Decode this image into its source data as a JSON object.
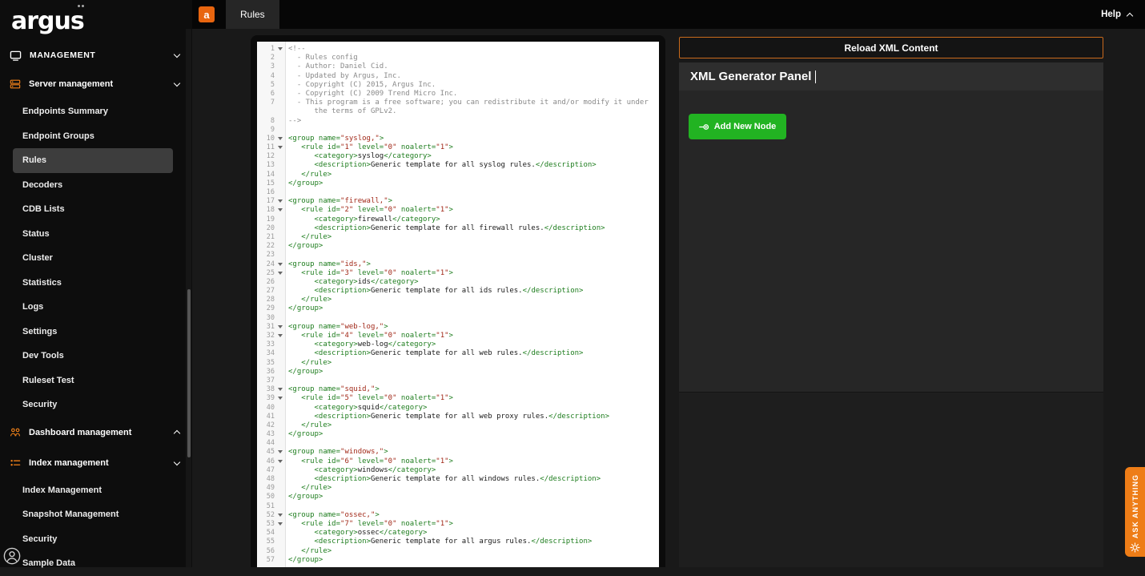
{
  "app": {
    "logo_text": "argus",
    "topbar": {
      "app_badge": "a",
      "tab_label": "Rules",
      "help_label": "Help"
    }
  },
  "sidebar": {
    "section_label": "MANAGEMENT",
    "items": [
      {
        "type": "group",
        "label": "Server management",
        "icon": "server",
        "chevron": "down"
      },
      {
        "type": "item",
        "label": "Endpoints Summary"
      },
      {
        "type": "item",
        "label": "Endpoint Groups"
      },
      {
        "type": "item",
        "label": "Rules",
        "selected": true
      },
      {
        "type": "item",
        "label": "Decoders"
      },
      {
        "type": "item",
        "label": "CDB Lists"
      },
      {
        "type": "item",
        "label": "Status"
      },
      {
        "type": "item",
        "label": "Cluster"
      },
      {
        "type": "item",
        "label": "Statistics"
      },
      {
        "type": "item",
        "label": "Logs"
      },
      {
        "type": "item",
        "label": "Settings"
      },
      {
        "type": "item",
        "label": "Dev Tools"
      },
      {
        "type": "item",
        "label": "Ruleset Test"
      },
      {
        "type": "item",
        "label": "Security"
      },
      {
        "type": "group",
        "label": "Dashboard management",
        "icon": "dashboard",
        "chevron": "up"
      },
      {
        "type": "group",
        "label": "Index management",
        "icon": "index",
        "chevron": "down"
      },
      {
        "type": "item",
        "label": "Index Management"
      },
      {
        "type": "item",
        "label": "Snapshot Management"
      },
      {
        "type": "item",
        "label": "Security"
      },
      {
        "type": "item",
        "label": "Sample Data"
      }
    ]
  },
  "panel": {
    "reload_button": "Reload XML Content",
    "title": "XML Generator Panel",
    "add_node_button": "Add New Node"
  },
  "ask_anything_label": "ASK ANYTHING",
  "colors": {
    "accent_orange": "#ee7d17",
    "green_button": "#22b322",
    "selected_item_bg": "#3d3d3d",
    "tag_green": "#1e7d1e",
    "string_red": "#a22a1a",
    "comment_gray": "#8a8a8a"
  },
  "editor": {
    "lines": [
      {
        "n": 1,
        "fold": true,
        "tokens": [
          [
            "c",
            "<!--"
          ]
        ]
      },
      {
        "n": 2,
        "tokens": [
          [
            "c",
            "  - Rules config"
          ]
        ]
      },
      {
        "n": 3,
        "tokens": [
          [
            "c",
            "  - Author: Daniel Cid."
          ]
        ]
      },
      {
        "n": 4,
        "tokens": [
          [
            "c",
            "  - Updated by Argus, Inc."
          ]
        ]
      },
      {
        "n": 5,
        "tokens": [
          [
            "c",
            "  - Copyright (C) 2015, Argus Inc."
          ]
        ]
      },
      {
        "n": 6,
        "tokens": [
          [
            "c",
            "  - Copyright (C) 2009 Trend Micro Inc."
          ]
        ]
      },
      {
        "n": 7,
        "tokens": [
          [
            "c",
            "  - This program is a free software; you can redistribute it and/or modify it under"
          ]
        ],
        "cont": "      the terms of GPLv2."
      },
      {
        "n": 8,
        "tokens": [
          [
            "c",
            "-->"
          ]
        ]
      },
      {
        "n": 9,
        "tokens": []
      },
      {
        "n": 10,
        "fold": true,
        "tokens": [
          [
            "g",
            "<group name="
          ],
          [
            "s",
            "\"syslog,\""
          ],
          [
            "g",
            ">"
          ]
        ]
      },
      {
        "n": 11,
        "fold": true,
        "tokens": [
          [
            "g",
            "   <rule id="
          ],
          [
            "s",
            "\"1\""
          ],
          [
            "g",
            " level="
          ],
          [
            "s",
            "\"0\""
          ],
          [
            "g",
            " noalert="
          ],
          [
            "s",
            "\"1\""
          ],
          [
            "g",
            ">"
          ]
        ]
      },
      {
        "n": 12,
        "tokens": [
          [
            "g",
            "      <category>"
          ],
          [
            "k",
            "syslog"
          ],
          [
            "g",
            "</category>"
          ]
        ]
      },
      {
        "n": 13,
        "tokens": [
          [
            "g",
            "      <description>"
          ],
          [
            "k",
            "Generic template for all syslog rules."
          ],
          [
            "g",
            "</description>"
          ]
        ]
      },
      {
        "n": 14,
        "tokens": [
          [
            "g",
            "   </rule>"
          ]
        ]
      },
      {
        "n": 15,
        "tokens": [
          [
            "g",
            "</group>"
          ]
        ]
      },
      {
        "n": 16,
        "tokens": []
      },
      {
        "n": 17,
        "fold": true,
        "tokens": [
          [
            "g",
            "<group name="
          ],
          [
            "s",
            "\"firewall,\""
          ],
          [
            "g",
            ">"
          ]
        ]
      },
      {
        "n": 18,
        "fold": true,
        "tokens": [
          [
            "g",
            "   <rule id="
          ],
          [
            "s",
            "\"2\""
          ],
          [
            "g",
            " level="
          ],
          [
            "s",
            "\"0\""
          ],
          [
            "g",
            " noalert="
          ],
          [
            "s",
            "\"1\""
          ],
          [
            "g",
            ">"
          ]
        ]
      },
      {
        "n": 19,
        "tokens": [
          [
            "g",
            "      <category>"
          ],
          [
            "k",
            "firewall"
          ],
          [
            "g",
            "</category>"
          ]
        ]
      },
      {
        "n": 20,
        "tokens": [
          [
            "g",
            "      <description>"
          ],
          [
            "k",
            "Generic template for all firewall rules."
          ],
          [
            "g",
            "</description>"
          ]
        ]
      },
      {
        "n": 21,
        "tokens": [
          [
            "g",
            "   </rule>"
          ]
        ]
      },
      {
        "n": 22,
        "tokens": [
          [
            "g",
            "</group>"
          ]
        ]
      },
      {
        "n": 23,
        "tokens": []
      },
      {
        "n": 24,
        "fold": true,
        "tokens": [
          [
            "g",
            "<group name="
          ],
          [
            "s",
            "\"ids,\""
          ],
          [
            "g",
            ">"
          ]
        ]
      },
      {
        "n": 25,
        "fold": true,
        "tokens": [
          [
            "g",
            "   <rule id="
          ],
          [
            "s",
            "\"3\""
          ],
          [
            "g",
            " level="
          ],
          [
            "s",
            "\"0\""
          ],
          [
            "g",
            " noalert="
          ],
          [
            "s",
            "\"1\""
          ],
          [
            "g",
            ">"
          ]
        ]
      },
      {
        "n": 26,
        "tokens": [
          [
            "g",
            "      <category>"
          ],
          [
            "k",
            "ids"
          ],
          [
            "g",
            "</category>"
          ]
        ]
      },
      {
        "n": 27,
        "tokens": [
          [
            "g",
            "      <description>"
          ],
          [
            "k",
            "Generic template for all ids rules."
          ],
          [
            "g",
            "</description>"
          ]
        ]
      },
      {
        "n": 28,
        "tokens": [
          [
            "g",
            "   </rule>"
          ]
        ]
      },
      {
        "n": 29,
        "tokens": [
          [
            "g",
            "</group>"
          ]
        ]
      },
      {
        "n": 30,
        "tokens": []
      },
      {
        "n": 31,
        "fold": true,
        "tokens": [
          [
            "g",
            "<group name="
          ],
          [
            "s",
            "\"web-log,\""
          ],
          [
            "g",
            ">"
          ]
        ]
      },
      {
        "n": 32,
        "fold": true,
        "tokens": [
          [
            "g",
            "   <rule id="
          ],
          [
            "s",
            "\"4\""
          ],
          [
            "g",
            " level="
          ],
          [
            "s",
            "\"0\""
          ],
          [
            "g",
            " noalert="
          ],
          [
            "s",
            "\"1\""
          ],
          [
            "g",
            ">"
          ]
        ]
      },
      {
        "n": 33,
        "tokens": [
          [
            "g",
            "      <category>"
          ],
          [
            "k",
            "web-log"
          ],
          [
            "g",
            "</category>"
          ]
        ]
      },
      {
        "n": 34,
        "tokens": [
          [
            "g",
            "      <description>"
          ],
          [
            "k",
            "Generic template for all web rules."
          ],
          [
            "g",
            "</description>"
          ]
        ]
      },
      {
        "n": 35,
        "tokens": [
          [
            "g",
            "   </rule>"
          ]
        ]
      },
      {
        "n": 36,
        "tokens": [
          [
            "g",
            "</group>"
          ]
        ]
      },
      {
        "n": 37,
        "tokens": []
      },
      {
        "n": 38,
        "fold": true,
        "tokens": [
          [
            "g",
            "<group name="
          ],
          [
            "s",
            "\"squid,\""
          ],
          [
            "g",
            ">"
          ]
        ]
      },
      {
        "n": 39,
        "fold": true,
        "tokens": [
          [
            "g",
            "   <rule id="
          ],
          [
            "s",
            "\"5\""
          ],
          [
            "g",
            " level="
          ],
          [
            "s",
            "\"0\""
          ],
          [
            "g",
            " noalert="
          ],
          [
            "s",
            "\"1\""
          ],
          [
            "g",
            ">"
          ]
        ]
      },
      {
        "n": 40,
        "tokens": [
          [
            "g",
            "      <category>"
          ],
          [
            "k",
            "squid"
          ],
          [
            "g",
            "</category>"
          ]
        ]
      },
      {
        "n": 41,
        "tokens": [
          [
            "g",
            "      <description>"
          ],
          [
            "k",
            "Generic template for all web proxy rules."
          ],
          [
            "g",
            "</description>"
          ]
        ]
      },
      {
        "n": 42,
        "tokens": [
          [
            "g",
            "   </rule>"
          ]
        ]
      },
      {
        "n": 43,
        "tokens": [
          [
            "g",
            "</group>"
          ]
        ]
      },
      {
        "n": 44,
        "tokens": []
      },
      {
        "n": 45,
        "fold": true,
        "tokens": [
          [
            "g",
            "<group name="
          ],
          [
            "s",
            "\"windows,\""
          ],
          [
            "g",
            ">"
          ]
        ]
      },
      {
        "n": 46,
        "fold": true,
        "tokens": [
          [
            "g",
            "   <rule id="
          ],
          [
            "s",
            "\"6\""
          ],
          [
            "g",
            " level="
          ],
          [
            "s",
            "\"0\""
          ],
          [
            "g",
            " noalert="
          ],
          [
            "s",
            "\"1\""
          ],
          [
            "g",
            ">"
          ]
        ]
      },
      {
        "n": 47,
        "tokens": [
          [
            "g",
            "      <category>"
          ],
          [
            "k",
            "windows"
          ],
          [
            "g",
            "</category>"
          ]
        ]
      },
      {
        "n": 48,
        "tokens": [
          [
            "g",
            "      <description>"
          ],
          [
            "k",
            "Generic template for all windows rules."
          ],
          [
            "g",
            "</description>"
          ]
        ]
      },
      {
        "n": 49,
        "tokens": [
          [
            "g",
            "   </rule>"
          ]
        ]
      },
      {
        "n": 50,
        "tokens": [
          [
            "g",
            "</group>"
          ]
        ]
      },
      {
        "n": 51,
        "tokens": []
      },
      {
        "n": 52,
        "fold": true,
        "tokens": [
          [
            "g",
            "<group name="
          ],
          [
            "s",
            "\"ossec,\""
          ],
          [
            "g",
            ">"
          ]
        ]
      },
      {
        "n": 53,
        "fold": true,
        "tokens": [
          [
            "g",
            "   <rule id="
          ],
          [
            "s",
            "\"7\""
          ],
          [
            "g",
            " level="
          ],
          [
            "s",
            "\"0\""
          ],
          [
            "g",
            " noalert="
          ],
          [
            "s",
            "\"1\""
          ],
          [
            "g",
            ">"
          ]
        ]
      },
      {
        "n": 54,
        "tokens": [
          [
            "g",
            "      <category>"
          ],
          [
            "k",
            "ossec"
          ],
          [
            "g",
            "</category>"
          ]
        ]
      },
      {
        "n": 55,
        "tokens": [
          [
            "g",
            "      <description>"
          ],
          [
            "k",
            "Generic template for all argus rules."
          ],
          [
            "g",
            "</description>"
          ]
        ]
      },
      {
        "n": 56,
        "tokens": [
          [
            "g",
            "   </rule>"
          ]
        ]
      },
      {
        "n": 57,
        "tokens": [
          [
            "g",
            "</group>"
          ]
        ]
      }
    ]
  }
}
